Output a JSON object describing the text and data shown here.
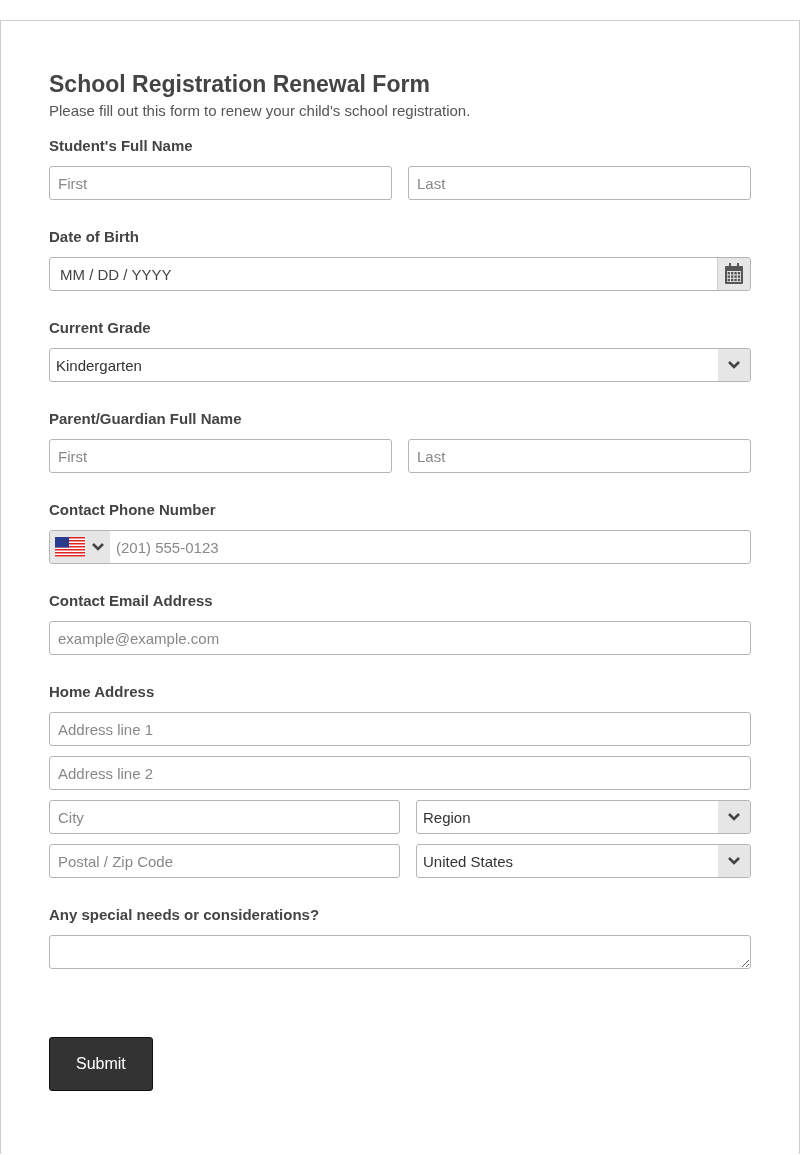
{
  "form": {
    "title": "School Registration Renewal Form",
    "subtitle": "Please fill out this form to renew your child's school registration.",
    "fields": [
      {
        "label": "Student's Full Name",
        "rows": [
          [
            {
              "kind": "text",
              "placeholder": "First"
            },
            {
              "kind": "text",
              "placeholder": "Last"
            }
          ]
        ]
      },
      {
        "label": "Date of Birth",
        "rows": [
          [
            {
              "kind": "date",
              "placeholder": "MM / DD / YYYY"
            }
          ]
        ]
      },
      {
        "label": "Current Grade",
        "rows": [
          [
            {
              "kind": "select",
              "value": "Kindergarten"
            }
          ]
        ]
      },
      {
        "label": "Parent/Guardian Full Name",
        "rows": [
          [
            {
              "kind": "text",
              "placeholder": "First"
            },
            {
              "kind": "text",
              "placeholder": "Last"
            }
          ]
        ]
      },
      {
        "label": "Contact Phone Number",
        "rows": [
          [
            {
              "kind": "phone",
              "placeholder": "(201) 555-0123"
            }
          ]
        ]
      },
      {
        "label": "Contact Email Address",
        "rows": [
          [
            {
              "kind": "text",
              "placeholder": "example@example.com"
            }
          ]
        ]
      },
      {
        "label": "Home Address",
        "rows": [
          [
            {
              "kind": "text",
              "placeholder": "Address line 1"
            }
          ],
          [
            {
              "kind": "text",
              "placeholder": "Address line 2"
            }
          ],
          [
            {
              "kind": "text",
              "placeholder": "City"
            },
            {
              "kind": "select",
              "value": "Region"
            }
          ],
          [
            {
              "kind": "text",
              "placeholder": "Postal / Zip Code"
            },
            {
              "kind": "select",
              "value": "United States"
            }
          ]
        ]
      },
      {
        "label": "Any special needs or considerations?",
        "rows": [
          [
            {
              "kind": "textarea"
            }
          ]
        ]
      }
    ],
    "submit": "Submit"
  }
}
